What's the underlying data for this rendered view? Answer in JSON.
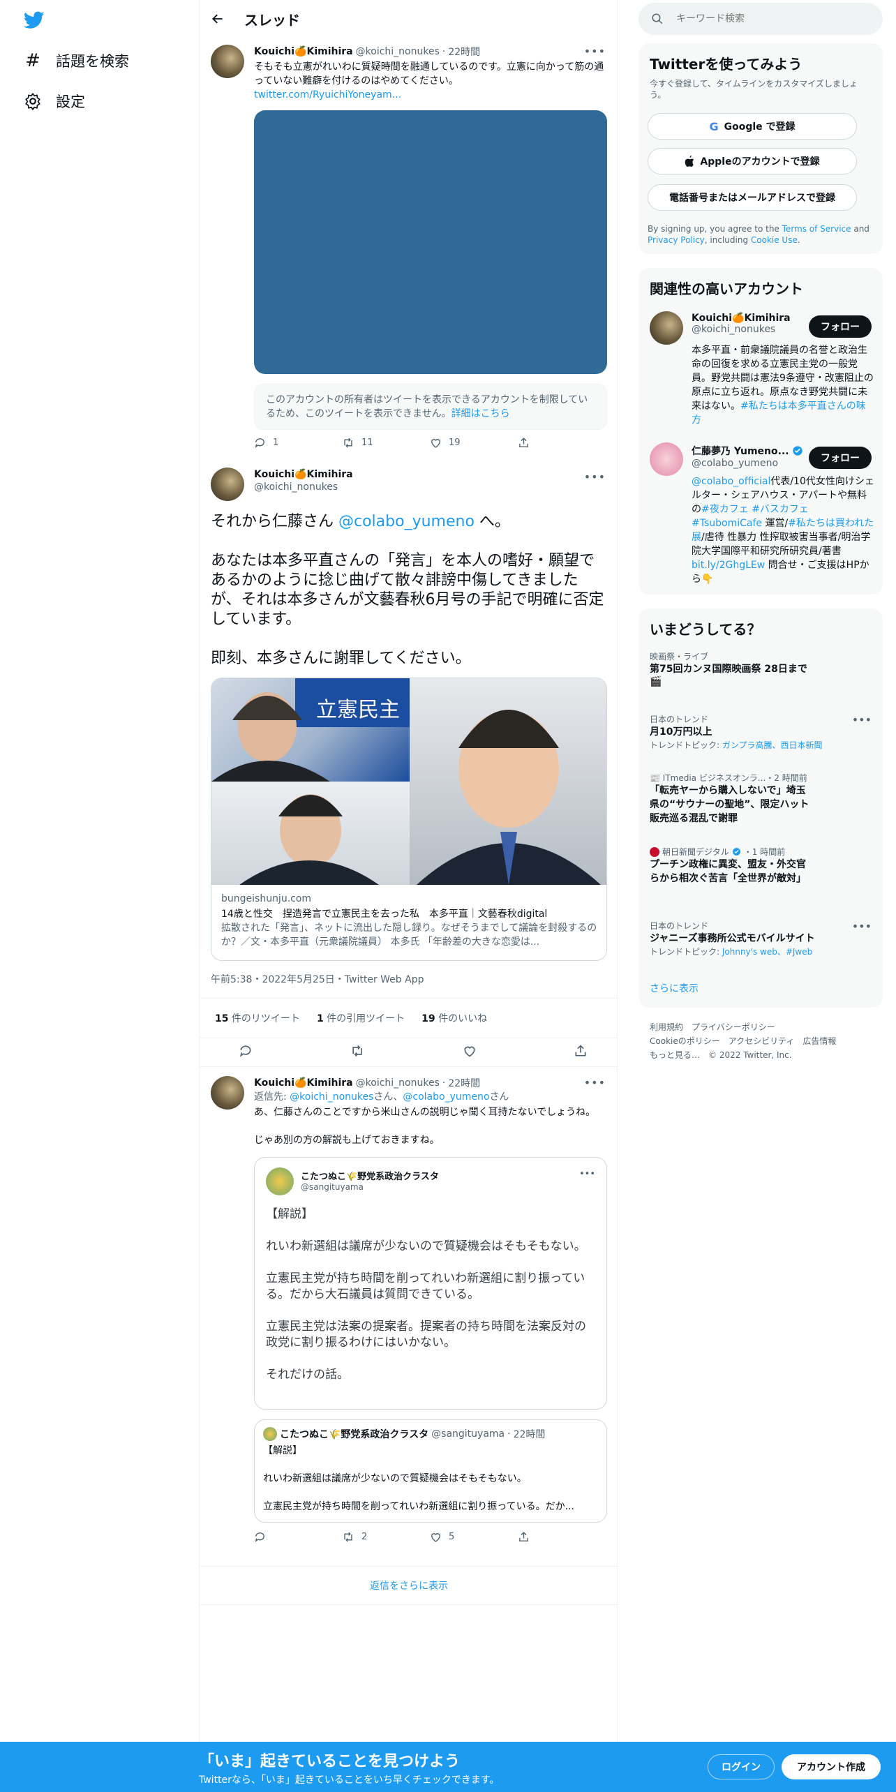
{
  "left_nav": {
    "explore_label": "話題を検索",
    "settings_label": "設定"
  },
  "header": {
    "title": "スレッド"
  },
  "tweet1": {
    "name": "Kouichi🍊Kimihira",
    "handle": "@koichi_nonukes",
    "time": "22時間",
    "text": "そもそも立憲がれいわに質疑時間を融通しているのです。立憲に向かって筋の通っていない難癖を付けるのはやめてください。",
    "link": "twitter.com/RyuichiYoneyam...",
    "restricted_text": "このアカウントの所有者はツイートを表示できるアカウントを制限しているため、このツイートを表示できません。",
    "restricted_link": "詳細はこちら",
    "replies": "1",
    "retweets": "11",
    "likes": "19"
  },
  "tweet2": {
    "name": "Kouichi🍊Kimihira",
    "handle": "@koichi_nonukes",
    "line1a": "それから仁藤さん ",
    "line1_mention": "@colabo_yumeno",
    "line1b": " へ。",
    "para2": "あなたは本多平直さんの「発言」を本人の嗜好・願望であるかのように捻じ曲げて散々誹謗中傷してきましたが、それは本多さんが文藝春秋6月号の手記で明確に否定しています。",
    "para3": "即刻、本多さんに謝罪してください。",
    "card_domain": "bungeishunju.com",
    "card_title": "14歳と性交　捏造発言で立憲民主を去った私　本多平直｜文藝春秋digital",
    "card_desc": "拡散された「発言」、ネットに流出した隠し録り。なぜそうまでして議論を封殺するのか？／文・本多平直（元衆議院議員） 本多氏 「年齢差の大きな恋愛は...",
    "timestamp": "午前5:38・2022年5月25日・Twitter Web App",
    "retweet_count": "15",
    "retweet_label": " 件のリツイート",
    "quote_count": "1",
    "quote_label": " 件の引用ツイート",
    "like_count": "19",
    "like_label": " 件のいいね"
  },
  "tweet3": {
    "name": "Kouichi🍊Kimihira",
    "handle": "@koichi_nonukes",
    "time": "22時間",
    "reply_prefix": "返信先: ",
    "reply_to1": "@koichi_nonukes",
    "reply_sep": "さん、",
    "reply_to2": "@colabo_yumeno",
    "reply_suffix": "さん",
    "text1": "あ、仁藤さんのことですから米山さんの説明じゃ聞く耳持たないでしょうね。",
    "text2": "じゃあ別の方の解説も上げておきますね。",
    "embed_name": "こたつぬこ🌾野党系政治クラスタ",
    "embed_handle": "@sangituyama",
    "embed_p1": "【解説】",
    "embed_p2": "れいわ新選組は議席が少ないので質疑機会はそもそもない。",
    "embed_p3": "立憲民主党が持ち時間を削ってれいわ新選組に割り振っている。だから大石議員は質問できている。",
    "embed_p4": "立憲民主党は法案の提案者。提案者の持ち時間を法案反対の政党に割り振るわけにはいかない。",
    "embed_p5": "それだけの話。",
    "quote_name": "こたつぬこ🌾野党系政治クラスタ",
    "quote_handle": "@sangituyama",
    "quote_time": "22時間",
    "quote_l1": "【解説】",
    "quote_l2": "れいわ新選組は議席が少ないので質疑機会はそもそもない。",
    "quote_l3": "立憲民主党が持ち時間を削ってれいわ新選組に割り振っている。だか...",
    "retweets": "2",
    "likes": "5"
  },
  "more_replies": "返信をさらに表示",
  "search": {
    "placeholder": "キーワード検索"
  },
  "signup": {
    "title": "Twitterを使ってみよう",
    "subtitle": "今すぐ登録して、タイムラインをカスタマイズしましょう。",
    "google": "Google で登録",
    "apple": "Appleのアカウントで登録",
    "phone": "電話番号またはメールアドレスで登録",
    "terms_a": "By signing up, you agree to the ",
    "terms_link": "Terms of Service",
    "terms_b": " and ",
    "privacy_link": "Privacy Policy",
    "terms_c": ", including ",
    "cookie_link": "Cookie Use",
    "terms_d": "."
  },
  "related": {
    "title": "関連性の高いアカウント",
    "follow_label": "フォロー",
    "acc1_name": "Kouichi🍊Kimihira",
    "acc1_handle": "@koichi_nonukes",
    "acc1_bio": "本多平直・前衆議院議員の名誉と政治生命の回復を求める立憲民主党の一般党員。野党共闘は憲法9条遵守・改憲阻止の原点に立ち返れ。原点なき野党共闘に未来はない。",
    "acc1_tag": "#私たちは本多平直さんの味方",
    "acc2_name": "仁藤夢乃 Yumeno...",
    "acc2_handle": "@colabo_yumeno",
    "acc2_bio_l1": "@colabo_official",
    "acc2_bio_l1b": "代表/10代女性向けシェルター・シェアハウス・アパートや無料の",
    "acc2_tag1": "#夜カフェ",
    "acc2_tag2": "#バスカフェ",
    "acc2_tag3": "#TsubomiCafe",
    "acc2_bio_l2": " 運営/",
    "acc2_tag4": "#私たちは買われた展",
    "acc2_bio_l3": "/虐待 性暴力 性搾取被害当事者/明治学院大学国際平和研究所研究員/著書",
    "acc2_link": "bit.ly/2GhgLEw",
    "acc2_bio_l4": " 問合せ・ご支援はHPから👇"
  },
  "trends": {
    "title": "いまどうしてる？",
    "t1_cat": "映画祭・ライブ",
    "t1_title": "第75回カンヌ国際映画祭 28日まで",
    "t2_cat": "日本のトレンド",
    "t2_title": "月10万円以上",
    "t2_topic_label": "トレンドトピック: ",
    "t2_topic": "ガンプラ高騰、西日本新聞",
    "t3_source": "ITmedia ビジネスオンラ...",
    "t3_time": "・2 時間前",
    "t3_title": "「転売ヤーから購入しないで」埼玉県の“サウナーの聖地”、限定ハット販売巡る混乱で謝罪",
    "t4_source": "朝日新聞デジタル",
    "t4_time": "・1 時間前",
    "t4_title": "プーチン政権に異変、盟友・外交官らから相次ぐ苦言「全世界が敵対」",
    "t5_cat": "日本のトレンド",
    "t5_title": "ジャニーズ事務所公式モバイルサイト",
    "t5_topic_label": "トレンドトピック: ",
    "t5_topic": "Johnny's web、#Jweb",
    "show_more": "さらに表示"
  },
  "footer": {
    "l1": "利用規約　プライバシーポリシー",
    "l2": "Cookieのポリシー　アクセシビリティ　広告情報",
    "l3": "もっと見る…　© 2022 Twitter, Inc."
  },
  "bottom_bar": {
    "title": "「いま」起きていることを見つけよう",
    "subtitle": "Twitterなら、「いま」起きていることをいち早くチェックできます。",
    "login": "ログイン",
    "signup": "アカウント作成"
  },
  "colors": {
    "accent": "#1d9bf0",
    "text": "#0f1419",
    "secondary": "#536471",
    "card_bg": "#f7f9f9"
  }
}
